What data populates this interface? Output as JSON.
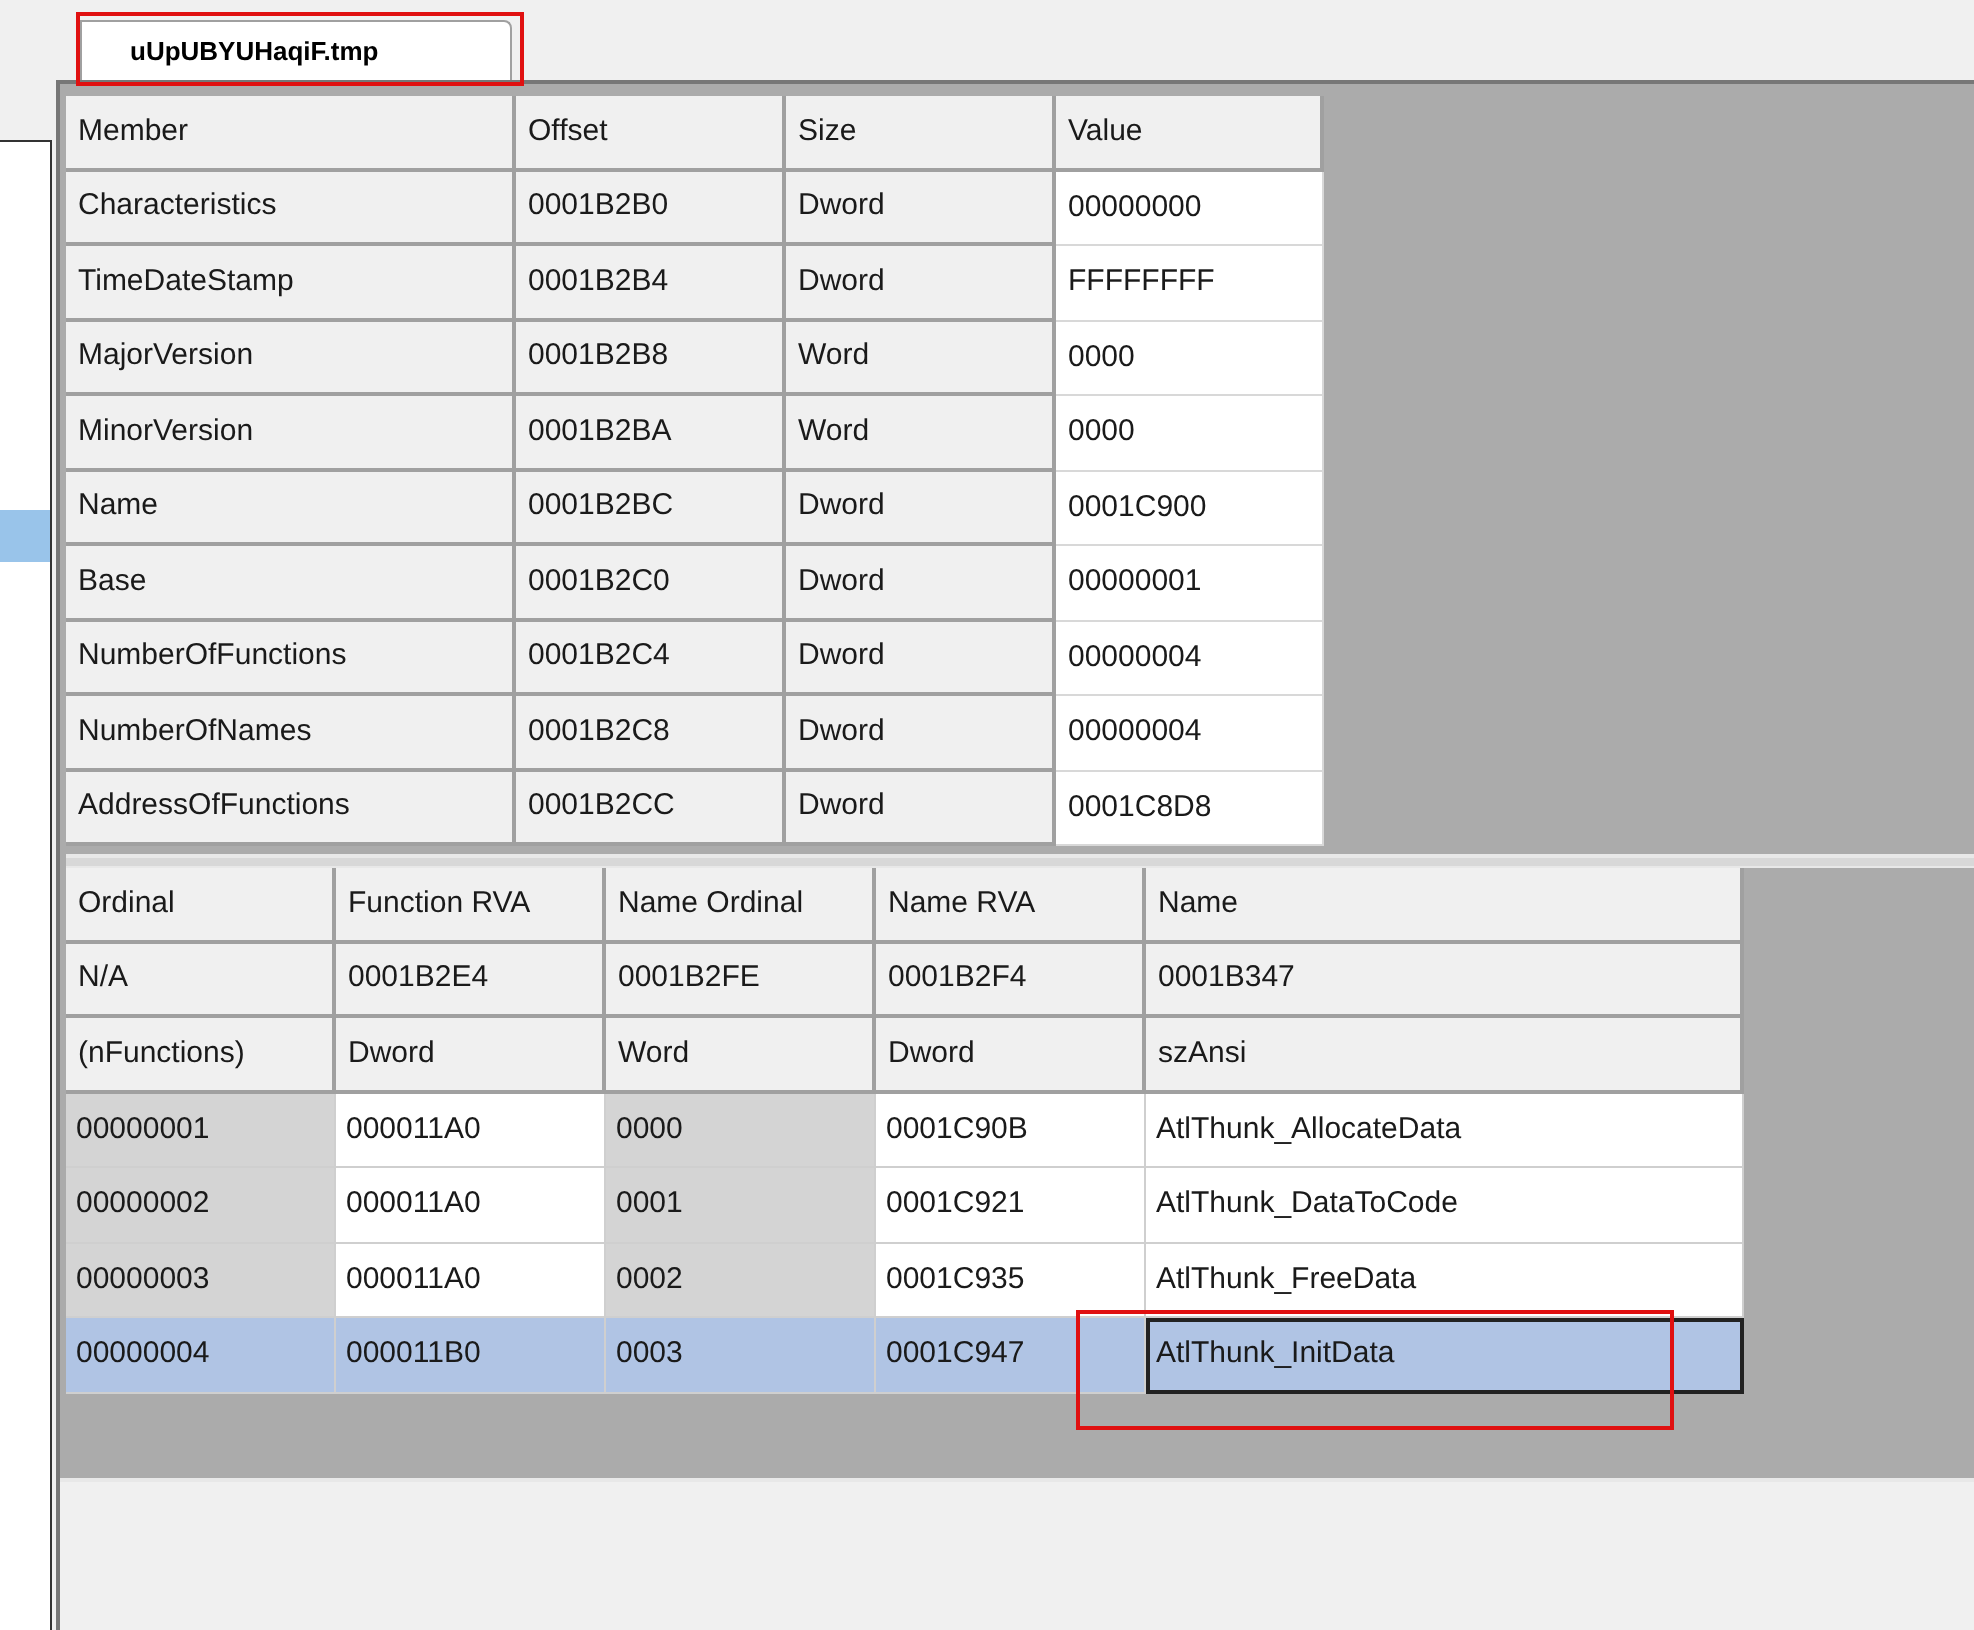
{
  "tab": {
    "label": "uUpUBYUHaqiF.tmp",
    "selected": true,
    "highlighted": true
  },
  "directory_table": {
    "columns": [
      {
        "label": "Member",
        "editable": false
      },
      {
        "label": "Offset",
        "editable": false
      },
      {
        "label": "Size",
        "editable": false
      },
      {
        "label": "Value",
        "editable": true
      }
    ],
    "rows": [
      [
        "Characteristics",
        "0001B2B0",
        "Dword",
        "00000000"
      ],
      [
        "TimeDateStamp",
        "0001B2B4",
        "Dword",
        "FFFFFFFF"
      ],
      [
        "MajorVersion",
        "0001B2B8",
        "Word",
        "0000"
      ],
      [
        "MinorVersion",
        "0001B2BA",
        "Word",
        "0000"
      ],
      [
        "Name",
        "0001B2BC",
        "Dword",
        "0001C900"
      ],
      [
        "Base",
        "0001B2C0",
        "Dword",
        "00000001"
      ],
      [
        "NumberOfFunctions",
        "0001B2C4",
        "Dword",
        "00000004"
      ],
      [
        "NumberOfNames",
        "0001B2C8",
        "Dword",
        "00000004"
      ],
      [
        "AddressOfFunctions",
        "0001B2CC",
        "Dword",
        "0001C8D8"
      ]
    ]
  },
  "exports_table": {
    "columns": [
      {
        "label": "Ordinal",
        "editable": false
      },
      {
        "label": "Function RVA",
        "editable": true
      },
      {
        "label": "Name Ordinal",
        "editable": false
      },
      {
        "label": "Name RVA",
        "editable": true
      },
      {
        "label": "Name",
        "editable": true
      }
    ],
    "info_rows": [
      [
        "N/A",
        "0001B2E4",
        "0001B2FE",
        "0001B2F4",
        "0001B347"
      ],
      [
        "(nFunctions)",
        "Dword",
        "Word",
        "Dword",
        "szAnsi"
      ]
    ],
    "rows": [
      {
        "cells": [
          "00000001",
          "000011A0",
          "0000",
          "0001C90B",
          "AtlThunk_AllocateData"
        ],
        "selected": false,
        "focused": false,
        "highlighted": false
      },
      {
        "cells": [
          "00000002",
          "000011A0",
          "0001",
          "0001C921",
          "AtlThunk_DataToCode"
        ],
        "selected": false,
        "focused": false,
        "highlighted": false
      },
      {
        "cells": [
          "00000003",
          "000011A0",
          "0002",
          "0001C935",
          "AtlThunk_FreeData"
        ],
        "selected": false,
        "focused": false,
        "highlighted": false
      },
      {
        "cells": [
          "00000004",
          "000011B0",
          "0003",
          "0001C947",
          "AtlThunk_InitData"
        ],
        "selected": true,
        "focused": true,
        "highlighted": true
      }
    ]
  }
}
